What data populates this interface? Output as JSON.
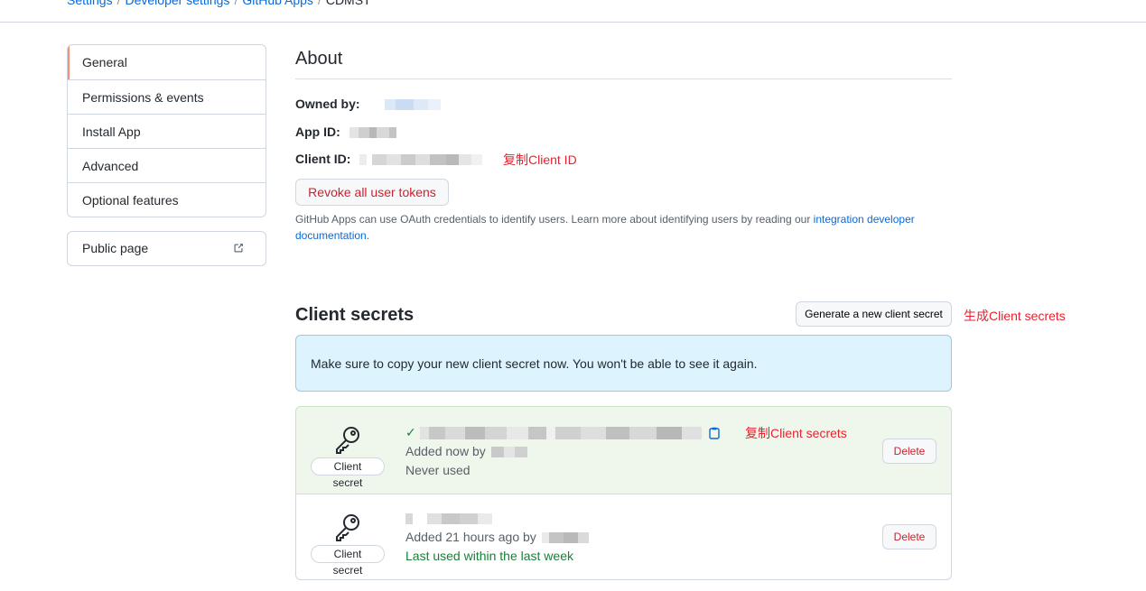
{
  "breadcrumb": {
    "items": [
      "Settings",
      "Developer settings",
      "GitHub Apps"
    ],
    "current": "CDMST"
  },
  "sidebar": {
    "items": [
      {
        "label": "General"
      },
      {
        "label": "Permissions & events"
      },
      {
        "label": "Install App"
      },
      {
        "label": "Advanced"
      },
      {
        "label": "Optional features"
      }
    ],
    "public_page": "Public page",
    "public_icon": "external-link-icon"
  },
  "about": {
    "title": "About",
    "owned_by_label": "Owned by:",
    "app_id_label": "App ID:",
    "client_id_label": "Client ID:",
    "annotation_copy_client_id": "复制Client ID",
    "revoke_button": "Revoke all user tokens",
    "help_text": "GitHub Apps can use OAuth credentials to identify users. Learn more about identifying users by reading our ",
    "help_link": "integration developer documentation",
    "help_period": "."
  },
  "client_secrets": {
    "title": "Client secrets",
    "generate_button": "Generate a new client secret",
    "annotation_generate": "生成Client secrets",
    "flash": "Make sure to copy your new client secret now. You won't be able to see it again.",
    "annotation_copy_secret": "复制Client secrets",
    "chip_label": "Client secret",
    "delete_label": "Delete",
    "secrets": [
      {
        "added": "Added now by",
        "usage": "Never used"
      },
      {
        "added": "Added 21 hours ago by",
        "usage": "Last used within the last week"
      }
    ]
  },
  "colors": {
    "link": "#0969da",
    "danger": "#cf222e",
    "annotation": "#e5232f",
    "success": "#1a7f37",
    "flash_bg": "#ddf4ff"
  }
}
